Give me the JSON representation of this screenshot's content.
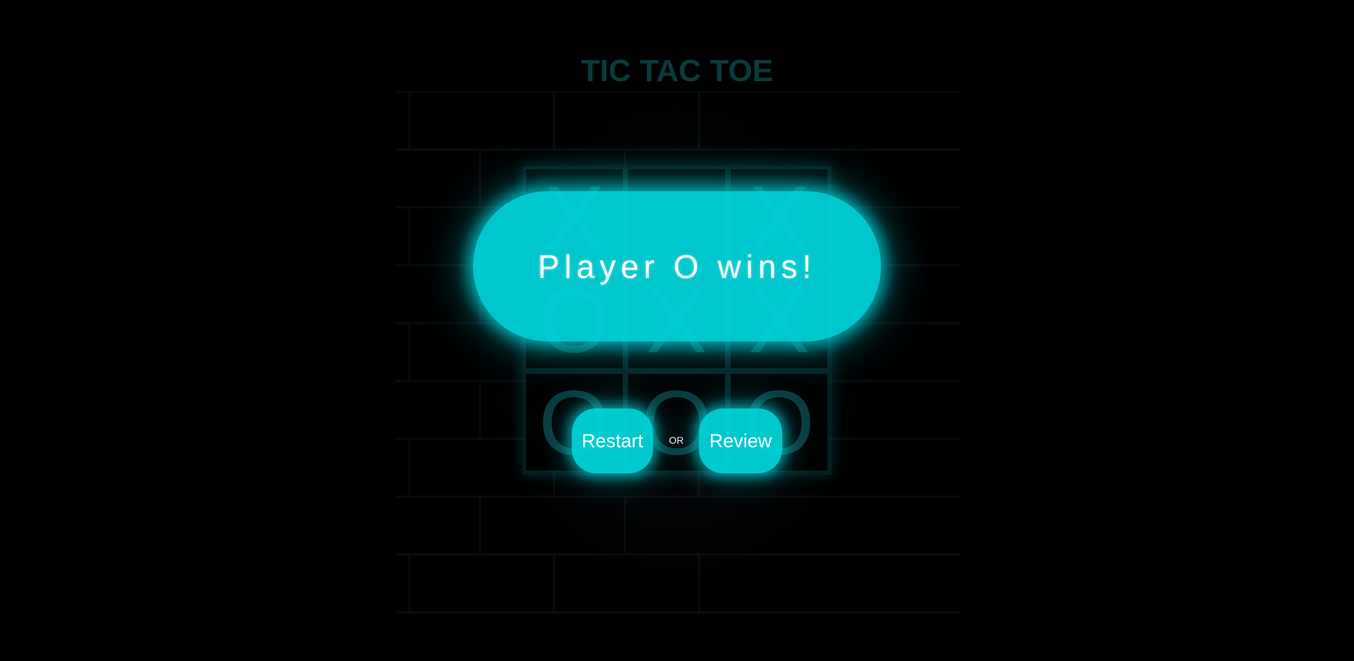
{
  "game": {
    "title": "TIC TAC TOE",
    "board": [
      [
        "X",
        "",
        "X"
      ],
      [
        "O",
        "X",
        "X"
      ],
      [
        "O",
        "O",
        "O"
      ]
    ]
  },
  "result_overlay": {
    "message": "Player O wins!",
    "restart_label": "Restart",
    "separator": "OR",
    "review_label": "Review"
  },
  "colors": {
    "accent": "#00d8de",
    "background": "#000000",
    "dim_accent": "#0a3b3e"
  }
}
